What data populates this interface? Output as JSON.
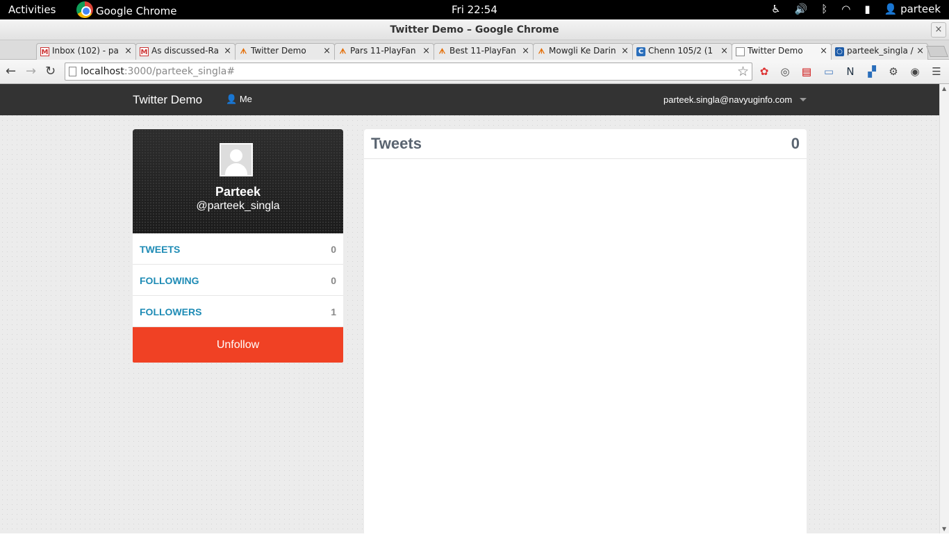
{
  "os_bar": {
    "activities": "Activities",
    "app_name": "Google Chrome",
    "clock": "Fri 22:54",
    "user": "parteek"
  },
  "window": {
    "title": "Twitter Demo – Google Chrome",
    "close": "×"
  },
  "tabs": [
    {
      "label": "Inbox (102) - pa",
      "icon": "gmail-icon"
    },
    {
      "label": "As discussed-Ra",
      "icon": "gmail-icon"
    },
    {
      "label": "Twitter Demo",
      "icon": "playfantasy-icon"
    },
    {
      "label": "Pars 11-PlayFan",
      "icon": "playfantasy-icon"
    },
    {
      "label": "Best 11-PlayFan",
      "icon": "playfantasy-icon"
    },
    {
      "label": "Mowgli Ke Darin",
      "icon": "playfantasy-icon"
    },
    {
      "label": "Chenn 105/2 (1",
      "icon": "cricket-icon"
    },
    {
      "label": "Twitter Demo",
      "icon": "page-icon",
      "active": true
    },
    {
      "label": "parteek_singla /",
      "icon": "site-icon"
    }
  ],
  "toolbar": {
    "url_host": "localhost",
    "url_path": ":3000/parteek_singla#"
  },
  "app": {
    "brand": "Twitter Demo",
    "nav_me": "Me",
    "user_email": "parteek.singla@navyuginfo.com"
  },
  "profile": {
    "name": "Parteek",
    "handle": "@parteek_singla",
    "stats": [
      {
        "label": "TWEETS",
        "value": "0"
      },
      {
        "label": "FOLLOWING",
        "value": "0"
      },
      {
        "label": "FOLLOWERS",
        "value": "1"
      }
    ],
    "action": "Unfollow"
  },
  "tweets_panel": {
    "heading": "Tweets",
    "count": "0"
  },
  "colors": {
    "accent_link": "#1e8bb5",
    "unfollow": "#f04124",
    "navbar": "#333333"
  }
}
